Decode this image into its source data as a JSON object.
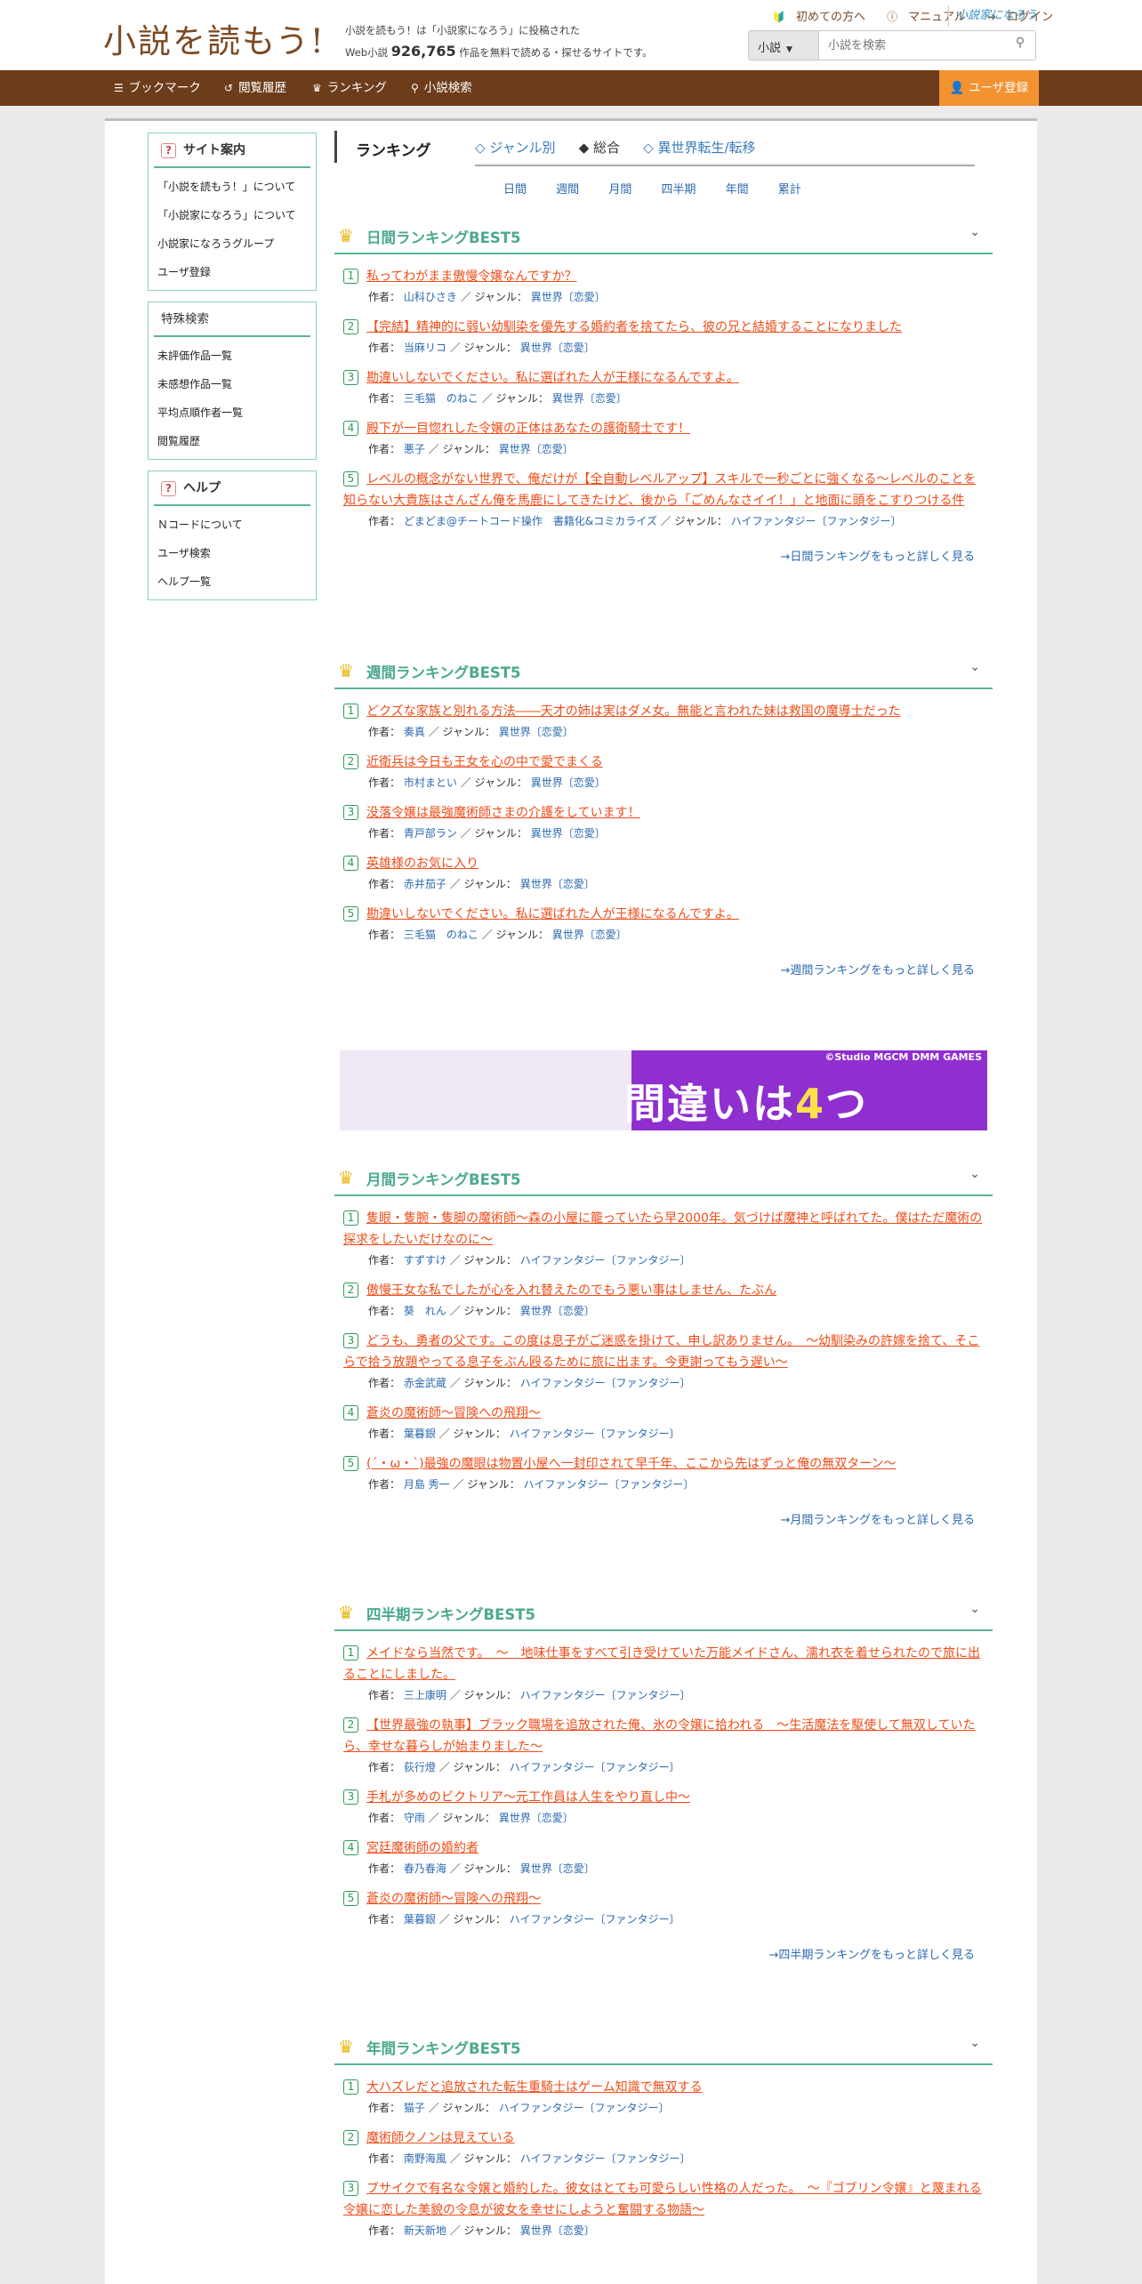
{
  "header": {
    "logo": "小説を読もう!",
    "desc_line1": "小説を読もう！は「小説家になろう」に投稿された",
    "desc_line2_prefix": "Web小説",
    "desc_count": "926,765",
    "desc_line2_suffix": "作品を無料で読める・探せるサイトです。",
    "top_links": [
      "初めての方へ",
      "マニュアル",
      "ログイン"
    ],
    "narou_logo": "小説家になろう",
    "search_select": "小説",
    "search_placeholder": "小説を検索"
  },
  "nav": {
    "items": [
      "ブックマーク",
      "閲覧履歴",
      "ランキング",
      "小説検索"
    ],
    "user_register": "ユーザ登録"
  },
  "sidebar": {
    "site_guide": {
      "title": "サイト案内",
      "items": [
        "「小説を読もう！」について",
        "「小説家になろう」について",
        "小説家になろうグループ",
        "ユーザ登録"
      ]
    },
    "special_search": {
      "title": "特殊検索",
      "items": [
        "未評価作品一覧",
        "未感想作品一覧",
        "平均点順作者一覧",
        "閲覧履歴"
      ]
    },
    "help": {
      "title": "ヘルプ",
      "items": [
        "Ｎコードについて",
        "ユーザ検索",
        "ヘルプ一覧"
      ]
    }
  },
  "ranking": {
    "title": "ランキング",
    "tabs": [
      "◇ ジャンル別",
      "◆ 総合",
      "◇ 異世界転生/転移"
    ],
    "periods": [
      "日間",
      "週間",
      "月間",
      "四半期",
      "年間",
      "累計"
    ],
    "author_label": "作者：",
    "genre_label": "／ ジャンル：",
    "sections": [
      {
        "title": "日間ランキングBEST5",
        "more": "→日間ランキングをもっと詳しく見る",
        "entries": [
          {
            "num": "1",
            "title": "私ってわがまま傲慢令嬢なんですか？",
            "author": "山科ひさき",
            "genre": "異世界〔恋愛〕"
          },
          {
            "num": "2",
            "title": "【完結】精神的に弱い幼馴染を優先する婚約者を捨てたら、彼の兄と結婚することになりました",
            "author": "当麻リコ",
            "genre": "異世界〔恋愛〕"
          },
          {
            "num": "3",
            "title": "勘違いしないでください。私に選ばれた人が王様になるんですよ。",
            "author": "三毛猫　のねこ",
            "genre": "異世界〔恋愛〕"
          },
          {
            "num": "4",
            "title": "殿下が一目惚れした令嬢の正体はあなたの護衛騎士です！",
            "author": "悪子",
            "genre": "異世界〔恋愛〕"
          },
          {
            "num": "5",
            "title": "レベルの概念がない世界で、俺だけが【全自動レベルアップ】スキルで一秒ごとに強くなる〜レベルのことを知らない大貴族はさんざん俺を馬鹿にしてきたけど、後から「ごめんなさイイ！」と地面に頭をこすりつける件",
            "author": "どまどま@チートコード操作　書籍化&コミカライズ",
            "genre": "ハイファンタジー〔ファンタジー〕"
          }
        ]
      },
      {
        "title": "週間ランキングBEST5",
        "more": "→週間ランキングをもっと詳しく見る",
        "entries": [
          {
            "num": "1",
            "title": "どクズな家族と別れる方法――天才の姉は実はダメ女。無能と言われた妹は救国の魔導士だった",
            "author": "奏真",
            "genre": "異世界〔恋愛〕"
          },
          {
            "num": "2",
            "title": "近衛兵は今日も王女を心の中で愛でまくる",
            "author": "市村まとい",
            "genre": "異世界〔恋愛〕"
          },
          {
            "num": "3",
            "title": "没落令嬢は最強魔術師さまの介護をしています！",
            "author": "青戸部ラン",
            "genre": "異世界〔恋愛〕"
          },
          {
            "num": "4",
            "title": "英雄様のお気に入り",
            "author": "赤井茄子",
            "genre": "異世界〔恋愛〕"
          },
          {
            "num": "5",
            "title": "勘違いしないでください。私に選ばれた人が王様になるんですよ。",
            "author": "三毛猫　のねこ",
            "genre": "異世界〔恋愛〕"
          }
        ]
      },
      {
        "title": "月間ランキングBEST5",
        "more": "→月間ランキングをもっと詳しく見る",
        "entries": [
          {
            "num": "1",
            "title": "隻眼・隻腕・隻脚の魔術師～森の小屋に籠っていたら早2000年。気づけば魔神と呼ばれてた。僕はただ魔術の探求をしたいだけなのに～",
            "author": "すずすけ",
            "genre": "ハイファンタジー〔ファンタジー〕"
          },
          {
            "num": "2",
            "title": "傲慢王女な私でしたが心を入れ替えたのでもう悪い事はしません、たぶん",
            "author": "葵　れん",
            "genre": "異世界〔恋愛〕"
          },
          {
            "num": "3",
            "title": "どうも、勇者の父です。この度は息子がご迷惑を掛けて、申し訳ありません。　～幼馴染みの許嫁を捨て、そこらで拾う放題やってる息子をぶん殴るために旅に出ます。今更謝ってもう遅い～",
            "author": "赤金武蔵",
            "genre": "ハイファンタジー〔ファンタジー〕"
          },
          {
            "num": "4",
            "title": "蒼炎の魔術師～冒険への飛翔～",
            "author": "葉暮銀",
            "genre": "ハイファンタジー〔ファンタジー〕"
          },
          {
            "num": "5",
            "title": "(´・ω・`)最強の魔眼は物置小屋へ一封印されて早千年、ここから先はずっと俺の無双ターン～",
            "author": "月島 秀一",
            "genre": "ハイファンタジー〔ファンタジー〕"
          }
        ]
      },
      {
        "title": "四半期ランキングBEST5",
        "more": "→四半期ランキングをもっと詳しく見る",
        "entries": [
          {
            "num": "1",
            "title": "メイドなら当然です。　～　地味仕事をすべて引き受けていた万能メイドさん、濡れ衣を着せられたので旅に出ることにしました。",
            "author": "三上康明",
            "genre": "ハイファンタジー〔ファンタジー〕"
          },
          {
            "num": "2",
            "title": "【世界最強の執事】ブラック職場を追放された俺、氷の令嬢に拾われる　～生活魔法を駆使して無双していたら、幸せな暮らしが始まりました～",
            "author": "荻行燈",
            "genre": "ハイファンタジー〔ファンタジー〕"
          },
          {
            "num": "3",
            "title": "手札が多めのビクトリア〜元工作員は人生をやり直し中〜",
            "author": "守雨",
            "genre": "異世界〔恋愛〕"
          },
          {
            "num": "4",
            "title": "宮廷魔術師の婚約者",
            "author": "春乃春海",
            "genre": "異世界〔恋愛〕"
          },
          {
            "num": "5",
            "title": "蒼炎の魔術師～冒険への飛翔～",
            "author": "葉暮銀",
            "genre": "ハイファンタジー〔ファンタジー〕"
          }
        ]
      },
      {
        "title": "年間ランキングBEST5",
        "more": "",
        "entries": [
          {
            "num": "1",
            "title": "大ハズレだと追放された転生重騎士はゲーム知識で無双する",
            "author": "猫子",
            "genre": "ハイファンタジー〔ファンタジー〕"
          },
          {
            "num": "2",
            "title": "魔術師クノンは見えている",
            "author": "南野海風",
            "genre": "ハイファンタジー〔ファンタジー〕"
          },
          {
            "num": "3",
            "title": "ブサイクで有名な令嬢と婚約した。彼女はとても可愛らしい性格の人だった。　～『ゴブリン令嬢』と蔑まれる令嬢に恋した美貌の令息が彼女を幸せにしようと奮闘する物語～",
            "author": "新天新地",
            "genre": "異世界〔恋愛〕"
          }
        ]
      }
    ]
  },
  "ad": {
    "copyright": "©Studio MGCM DMM GAMES",
    "catch_before": "間違いは",
    "catch_num": "4",
    "catch_after": "つ"
  },
  "colors": {
    "brand_brown": "#6d3c1a",
    "accent_orange": "#f39230",
    "title_link": "#ef4d18",
    "section_teal": "#4aa98e",
    "link_blue": "#2c6ab0"
  }
}
